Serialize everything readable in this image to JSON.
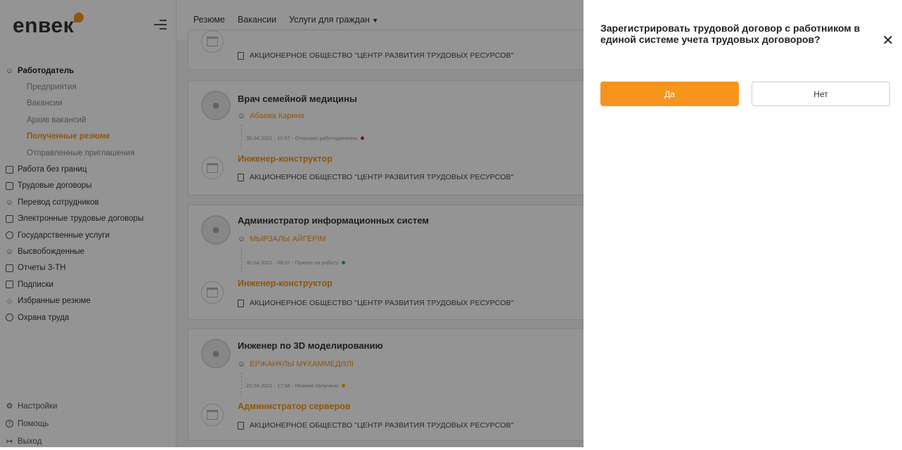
{
  "logo": {
    "text": "enвек"
  },
  "sidebar": {
    "section_title": "Работодатель",
    "sub_items": [
      {
        "label": "Предприятия"
      },
      {
        "label": "Вакансии"
      },
      {
        "label": "Архив вакансий"
      },
      {
        "label": "Полученные резюме"
      },
      {
        "label": "Отправленные приглашения"
      }
    ],
    "items": [
      {
        "label": "Работа без границ"
      },
      {
        "label": "Трудовые договоры"
      },
      {
        "label": "Перевод сотрудников"
      },
      {
        "label": "Электронные трудовые договоры"
      },
      {
        "label": "Государственные услуги"
      },
      {
        "label": "Высвобожденные"
      },
      {
        "label": "Отчеты 3-ТН"
      },
      {
        "label": "Подписки"
      },
      {
        "label": "Избранные резюме"
      },
      {
        "label": "Охрана труда"
      }
    ],
    "bottom": [
      {
        "label": "Настройки"
      },
      {
        "label": "Помощь"
      },
      {
        "label": "Выход"
      }
    ]
  },
  "topnav": {
    "resume": "Резюме",
    "vacancies": "Вакансии",
    "services": "Услуги для граждан"
  },
  "cards": [
    {
      "org": "АКЦИОНЕРНОЕ ОБЩЕСТВО \"ЦЕНТР РАЗВИТИЯ ТРУДОВЫХ РЕСУРСОВ\""
    },
    {
      "title": "Врач семейной медицины",
      "person": "Абаева Карина",
      "status": "30.04.2021 - 10:57 - Отказано работодателем",
      "status_color": "#e0241c",
      "position": "Инженер-конструктор",
      "org": "АКЦИОНЕРНОЕ ОБЩЕСТВО \"ЦЕНТР РАЗВИТИЯ ТРУДОВЫХ РЕСУРСОВ\""
    },
    {
      "title": "Администратор информационных систем",
      "person": "МЫРЗАЛЫ АЙГЕРІМ",
      "status": "30.04.2021 - 09:37 - Принят на работу",
      "status_color": "#2fb34a",
      "position": "Инженер-конструктор",
      "org": "АКЦИОНЕРНОЕ ОБЩЕСТВО \"ЦЕНТР РАЗВИТИЯ ТРУДОВЫХ РЕСУРСОВ\""
    },
    {
      "title": "Инженер по 3D моделированию",
      "person": "ЕРЖАНҰЛЫ МҰХАММЕДӘЛІ",
      "status": "29.04.2021 - 17:56 - Резюме получено",
      "status_color": "#f2b705",
      "position": "Администратор серверов",
      "org": "АКЦИОНЕРНОЕ ОБЩЕСТВО \"ЦЕНТР РАЗВИТИЯ ТРУДОВЫХ РЕСУРСОВ\""
    }
  ],
  "modal": {
    "title": "Зарегистрировать трудовой договор с работником в единой системе учета трудовых договоров?",
    "yes_label": "Да",
    "no_label": "Нет"
  },
  "colors": {
    "accent": "#f7941d",
    "overlay": "rgba(0,0,0,0.42)"
  }
}
